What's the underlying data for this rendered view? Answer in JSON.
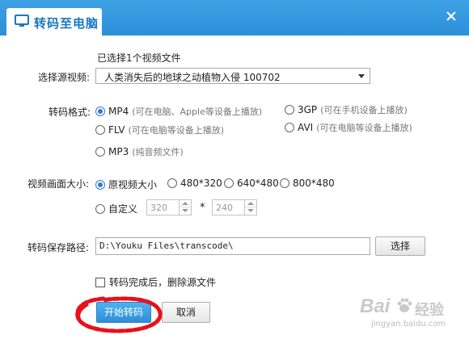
{
  "window": {
    "title": "转码至电脑"
  },
  "source": {
    "selected_count_text": "已选择1个视频文件",
    "label": "选择源视频:",
    "value": "人类消失后的地球之动植物入侵 100702"
  },
  "format": {
    "label": "转码格式:",
    "options": [
      {
        "label": "MP4",
        "hint": "(可在电脑、Apple等设备上播放)",
        "selected": true
      },
      {
        "label": "3GP",
        "hint": "(可在手机设备上播放)",
        "selected": false
      },
      {
        "label": "FLV",
        "hint": "(可在电脑等设备上播放)",
        "selected": false
      },
      {
        "label": "AVI",
        "hint": "(可在电脑等设备上播放)",
        "selected": false
      },
      {
        "label": "MP3",
        "hint": "(纯音频文件)",
        "selected": false
      }
    ]
  },
  "size": {
    "label": "视频画面大小:",
    "options": [
      {
        "label": "原视频大小",
        "selected": true
      },
      {
        "label": "480*320",
        "selected": false
      },
      {
        "label": "640*480",
        "selected": false
      },
      {
        "label": "800*480",
        "selected": false
      },
      {
        "label": "自定义",
        "selected": false
      }
    ],
    "custom_width": "320",
    "custom_height": "240",
    "separator": "*"
  },
  "output": {
    "label": "转码保存路径:",
    "path": "D:\\Youku Files\\transcode\\",
    "browse_label": "选择"
  },
  "delete_source": {
    "label": "转码完成后，删除源文件",
    "checked": false
  },
  "actions": {
    "start_label": "开始转码",
    "cancel_label": "取消"
  },
  "watermark": {
    "brand": "Bai",
    "brand_cn": "经验",
    "url": "jingyan.baidu.com"
  },
  "colors": {
    "titlebar": "#2c8fd8",
    "accent": "#2b7bd3",
    "annotation": "#e8101a"
  }
}
